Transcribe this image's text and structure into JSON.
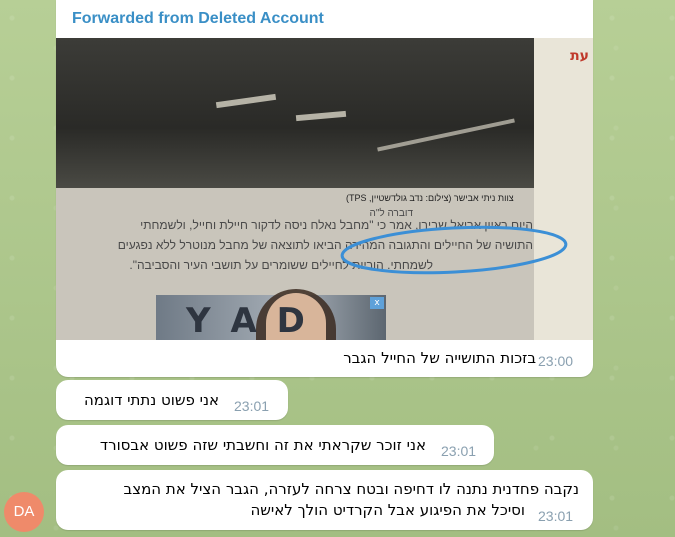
{
  "messages": [
    {
      "forwarded_from": "Forwarded from Deleted Account",
      "photo": {
        "side_title": "עת",
        "caption": "צוות ניתי אבישר (צילום: נדב גולדשטיין, TPS)",
        "article_lines": [
          "דוברה ל\"ה",
          "היום ראיון אריאל שבירו, אמר כי \"מחבל נאלח ניסה לדקור חיילת וחייל, ולשמחתי",
          "התושיה של החיילים והתגובה המהירה הביאו לתוצאה של מחבל מנוטרל ללא נפגעים",
          "לשמחתי. הוריות לחיילים ששומרים על תושבי העיר והסביבה\"."
        ],
        "ad_letters": "Y A D",
        "ad_close": "x"
      },
      "text": "בזכות התושייה של החייל הגבר",
      "time": "23:00"
    },
    {
      "text": "אני פשוט נתתי דוגמה",
      "time": "23:01"
    },
    {
      "text": "אני זוכר שקראתי את זה וחשבתי שזה פשוט אבסורד",
      "time": "23:01"
    },
    {
      "text_lines": [
        "נקבה פחדנית נתנה לו דחיפה ובטח צרחה לעזרה, הגבר הציל את המצב",
        "וסיכל את הפיגוע אבל הקרדיט הולך לאישה"
      ],
      "time": "23:01"
    }
  ],
  "sender": {
    "initials": "DA",
    "avatar_color": "#ef8a6a"
  },
  "colors": {
    "forward_label": "#3a8fc6",
    "time": "#8aa0b0",
    "background": "#a9c48a",
    "highlight_circle": "#3b8fd6"
  }
}
